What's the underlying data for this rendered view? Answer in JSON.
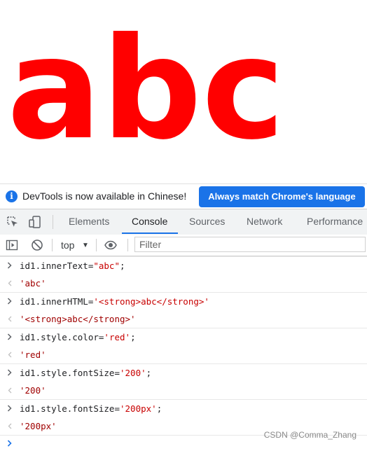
{
  "page": {
    "rendered_text": "abc",
    "text_color": "#ff0000"
  },
  "infobar": {
    "message": "DevTools is now available in Chinese!",
    "button_label": "Always match Chrome's language",
    "accent": "#1a73e8"
  },
  "tabs": {
    "elements": "Elements",
    "console": "Console",
    "sources": "Sources",
    "network": "Network",
    "performance": "Performance"
  },
  "console_toolbar": {
    "context": "top",
    "filter_placeholder": "Filter"
  },
  "console": {
    "entries": [
      {
        "type": "input",
        "prefix": "id1.innerText=",
        "string": "\"abc\"",
        "suffix": ";"
      },
      {
        "type": "result",
        "text": "'abc'"
      },
      {
        "type": "input",
        "prefix": "id1.innerHTML=",
        "string": "'<strong>abc</strong>'",
        "suffix": ""
      },
      {
        "type": "result",
        "text": "'<strong>abc</strong>'"
      },
      {
        "type": "input",
        "prefix": "id1.style.color=",
        "string": "'red'",
        "suffix": ";"
      },
      {
        "type": "result",
        "text": "'red'"
      },
      {
        "type": "input",
        "prefix": "id1.style.fontSize=",
        "string": "'200'",
        "suffix": ";"
      },
      {
        "type": "result",
        "text": "'200'"
      },
      {
        "type": "input",
        "prefix": "id1.style.fontSize=",
        "string": "'200px'",
        "suffix": ";"
      },
      {
        "type": "result",
        "text": "'200px'"
      }
    ]
  },
  "watermark": "CSDN @Comma_Zhang"
}
